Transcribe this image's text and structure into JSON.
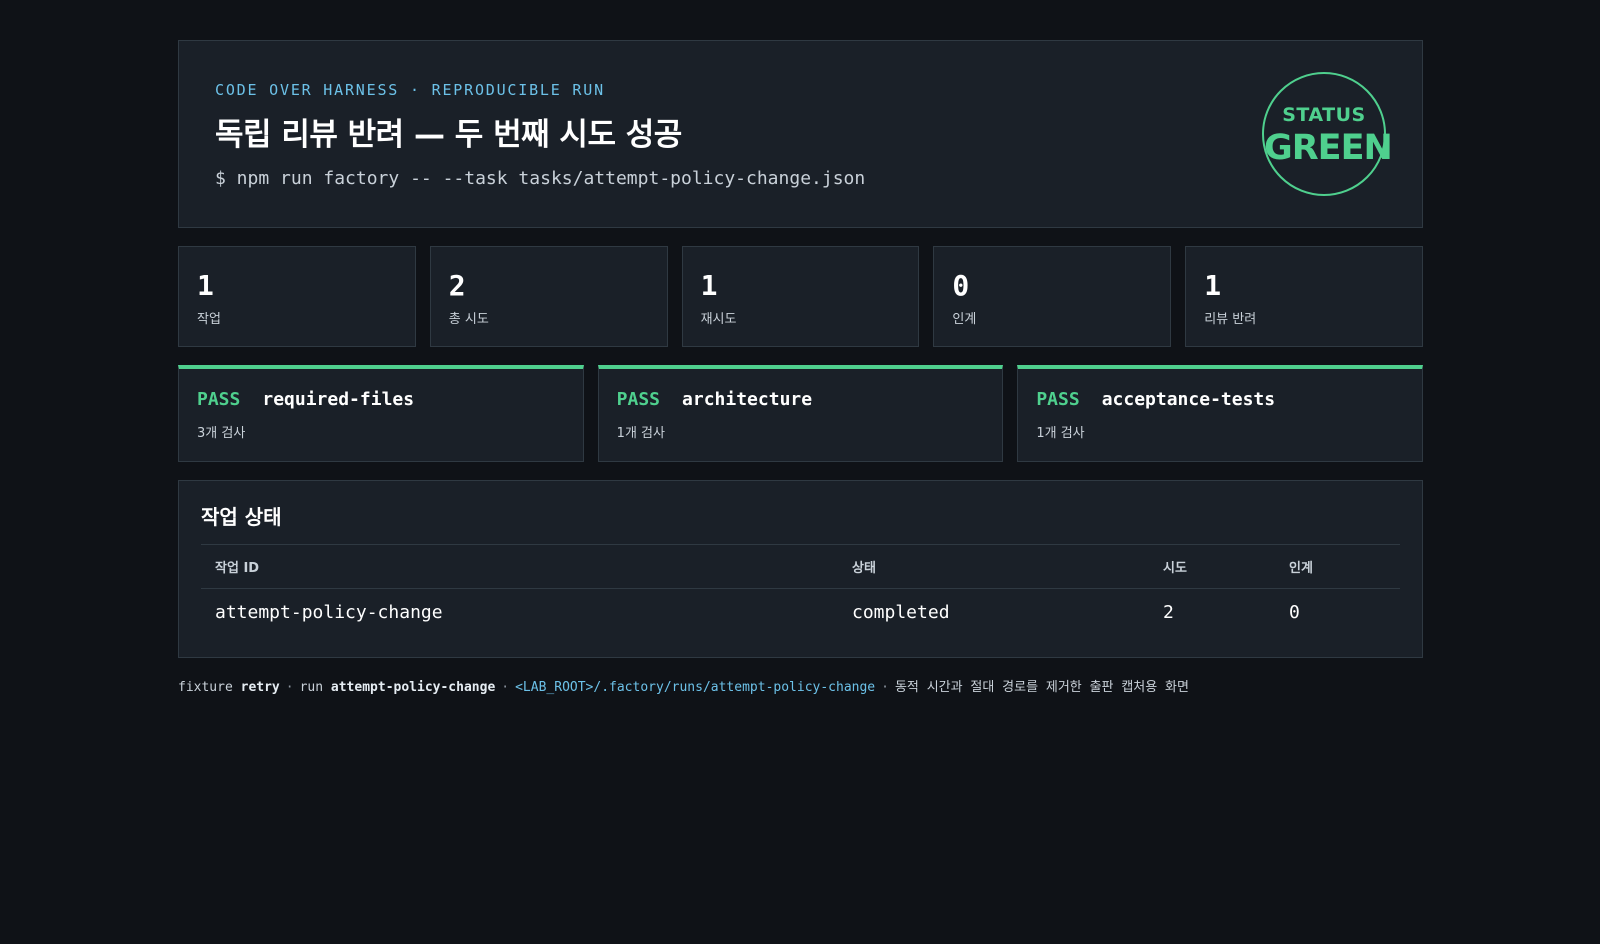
{
  "header": {
    "eyebrow": "CODE OVER HARNESS · REPRODUCIBLE RUN",
    "title": "독립 리뷰 반려 — 두 번째 시도 성공",
    "command": "$ npm run factory -- --task tasks/attempt-policy-change.json",
    "status_label": "STATUS",
    "status_value": "GREEN"
  },
  "stats": [
    {
      "value": "1",
      "label": "작업"
    },
    {
      "value": "2",
      "label": "총 시도"
    },
    {
      "value": "1",
      "label": "재시도"
    },
    {
      "value": "0",
      "label": "인계"
    },
    {
      "value": "1",
      "label": "리뷰 반려"
    }
  ],
  "checks": [
    {
      "result": "PASS",
      "name": "required-files",
      "count": "3개 검사"
    },
    {
      "result": "PASS",
      "name": "architecture",
      "count": "1개 검사"
    },
    {
      "result": "PASS",
      "name": "acceptance-tests",
      "count": "1개 검사"
    }
  ],
  "tasks": {
    "title": "작업 상태",
    "columns": [
      "작업 ID",
      "상태",
      "시도",
      "인계"
    ],
    "rows": [
      [
        "attempt-policy-change",
        "completed",
        "2",
        "0"
      ]
    ]
  },
  "footer": {
    "fixture_label": "fixture",
    "fixture_value": "retry",
    "run_label": "run",
    "run_value": "attempt-policy-change",
    "path": "<LAB_ROOT>/.factory/runs/attempt-policy-change",
    "note": "동적 시간과 절대 경로를 제거한 출판 캡처용 화면",
    "separator": "·"
  },
  "colors": {
    "background": "#0f1217",
    "panel": "#1a2028",
    "accent_green": "#4fd08e",
    "accent_blue": "#6cc1e8"
  }
}
